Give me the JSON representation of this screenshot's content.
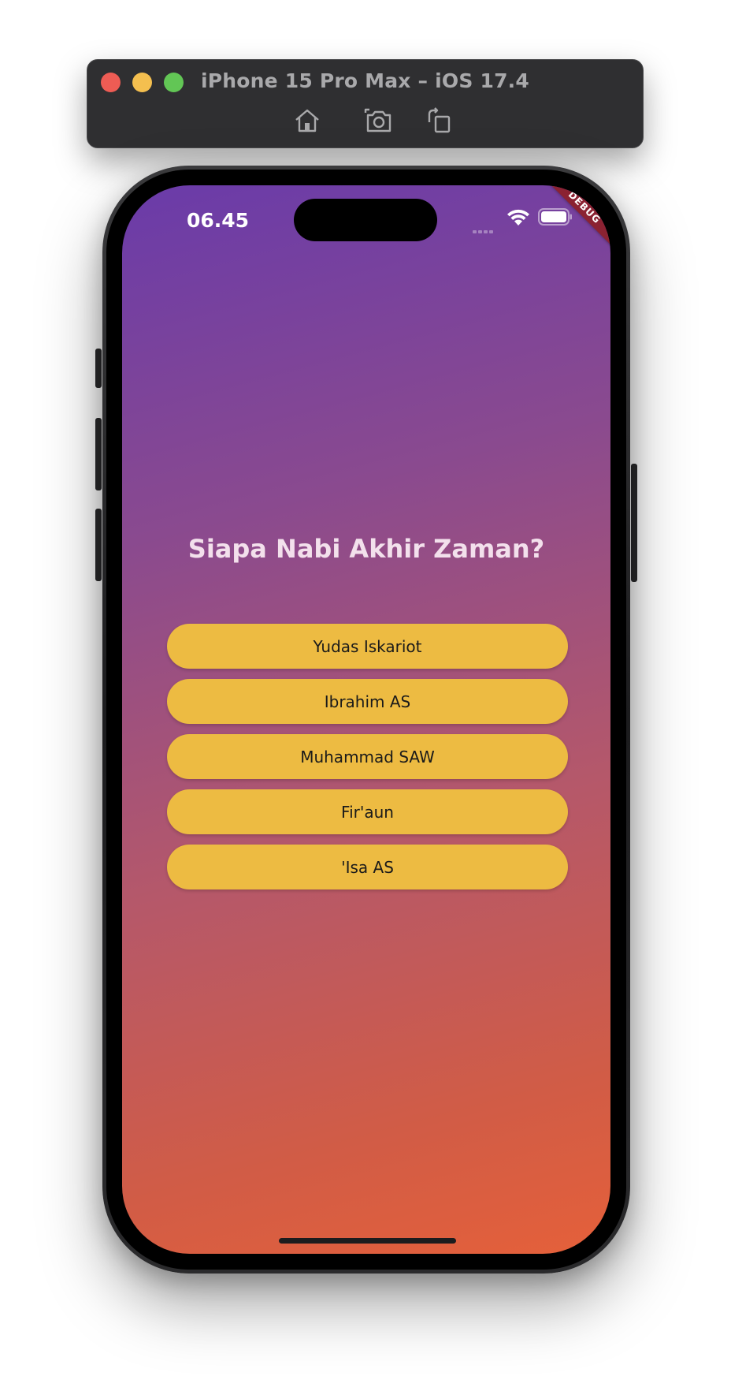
{
  "simulator": {
    "title": "iPhone 15 Pro Max – iOS 17.4",
    "toolbar": [
      "home-icon",
      "screenshot-icon",
      "rotate-icon"
    ]
  },
  "status_bar": {
    "time": "06.45",
    "debug_label": "DEBUG"
  },
  "quiz": {
    "question": "Siapa Nabi Akhir Zaman?",
    "answers": [
      "Yudas Iskariot",
      "Ibrahim AS",
      "Muhammad SAW",
      "Fir'aun",
      "'Isa AS"
    ]
  },
  "colors": {
    "gradient_top": "#6a3ba9",
    "gradient_bottom": "#e5603a",
    "answer_button": "#edbb42",
    "question_text": "#f3e0ec"
  }
}
